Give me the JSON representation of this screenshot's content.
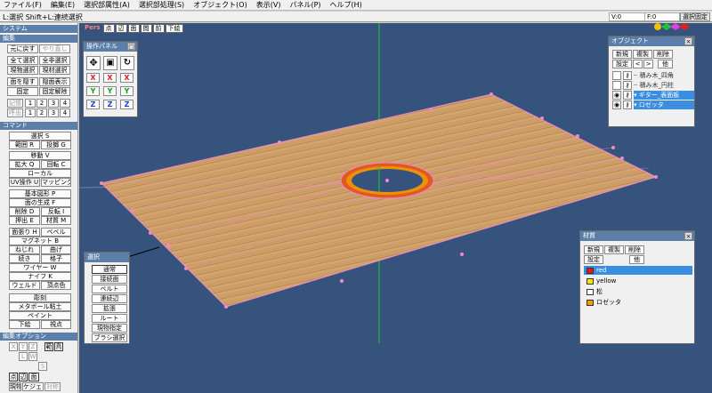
{
  "menu": {
    "items": [
      "ファイル(F)",
      "編集(E)",
      "選択部属性(A)",
      "選択部処理(S)",
      "オブジェクト(O)",
      "表示(V)",
      "パネル(P)",
      "ヘルプ(H)"
    ]
  },
  "status": {
    "hint": "L:選択  Shift+L:連続選択",
    "v": "V:0",
    "f": "F:0",
    "button": "選択固定"
  },
  "left_panel": {
    "system_title": "システム",
    "edit_title": "編集",
    "undo": "元に戻す",
    "redo": "やり直し",
    "select_all": "全て選択",
    "select_all_vis": "全非選択",
    "select_current": "現物選択",
    "current_select": "現材選択",
    "hide_face": "面を隠す",
    "show_face": "隠面表示",
    "fix": "固定",
    "unfix": "固定解除",
    "memory": "記憶",
    "recall": "呼出",
    "nums": [
      "1",
      "2",
      "3",
      "4"
    ],
    "command_title": "コマンド",
    "select_s": "選択 S",
    "range_r": "範囲 R",
    "knife_g": "投擲 G",
    "move_v": "移動 V",
    "scale_q": "拡大 Q",
    "rotate_c": "回転 C",
    "local": "ローカル",
    "uv": "UV操作 U",
    "mapping": "マッピング",
    "basic_shape": "基本図形 P",
    "face_gen": "面の生成 F",
    "delete_d": "削除 D",
    "flip_i": "反転 I",
    "extrude_e": "押出 E",
    "material_m": "材質 M",
    "bevel_h": "面張り H",
    "bevel": "ベベル",
    "magnet": "マグネット B",
    "twist": "ねじれ",
    "bend": "曲げ",
    "lathe": "続き",
    "lattice": "格子",
    "wire": "ワイヤー W",
    "knife_k": "ナイフ K",
    "weld": "ウェルド",
    "vertex_color": "頂点色",
    "sculpt": "彫刻",
    "metaball": "メタボール粘土",
    "paint": "ペイント",
    "draw": "下絵",
    "vertex": "視点",
    "edit_option_title": "編集オプション",
    "x": "X",
    "y": "Y",
    "z": "Z",
    "range_label": "範",
    "snap_label": "鳥",
    "l": "L",
    "w": "W",
    "s": "S",
    "point": "点",
    "edge": "辺",
    "face": "面",
    "current_obj": "現物",
    "widget": "ケジェット",
    "symmetry": "対称"
  },
  "view_toolbar": {
    "pers": "Pers",
    "point": "点",
    "edge": "辺",
    "face": "面",
    "wire": "閲",
    "front": "前",
    "draw": "下絵"
  },
  "op_panel": {
    "title": "操作パネル",
    "close": "□",
    "rows": [
      [
        "X",
        "X",
        "X"
      ],
      [
        "Y",
        "Y",
        "Y"
      ],
      [
        "Z",
        "Z",
        "Z"
      ]
    ]
  },
  "select_panel": {
    "title": "選択",
    "items": [
      "通常",
      "接続面",
      "ベルト",
      "連続辺",
      "拡張",
      "ルート",
      "現物指定",
      "ブラシ選択"
    ]
  },
  "object_panel": {
    "title": "オブジェクト",
    "close": "×",
    "new": "新規",
    "clone": "複製",
    "delete": "削除",
    "settings": "設定",
    "prev": "<",
    "next": ">",
    "other": "他",
    "objects": [
      {
        "name": "積み木_四角",
        "selected": false
      },
      {
        "name": "積み木_円柱",
        "selected": false
      },
      {
        "name": "ギター_表面板",
        "selected": true
      },
      {
        "name": "ロゼッタ",
        "selected": true
      }
    ]
  },
  "material_panel": {
    "title": "材質",
    "close": "×",
    "new": "新規",
    "clone": "複製",
    "delete": "削除",
    "settings": "設定",
    "other": "他",
    "materials": [
      {
        "name": "red",
        "color": "#e01818",
        "selected": true
      },
      {
        "name": "yellow",
        "color": "#f5e800",
        "selected": false
      },
      {
        "name": "松",
        "color": "#ffffff",
        "selected": false
      },
      {
        "name": "ロゼッタ",
        "color": "#f0a000",
        "selected": false
      }
    ]
  },
  "colors": {
    "viewport_bg": "#35537c",
    "panel_title": "#5b7fa8",
    "selection": "#3b8de0",
    "wood_light": "#d2a46e",
    "wood_dark": "#b07a48",
    "edge_pink": "#f08ac8"
  }
}
